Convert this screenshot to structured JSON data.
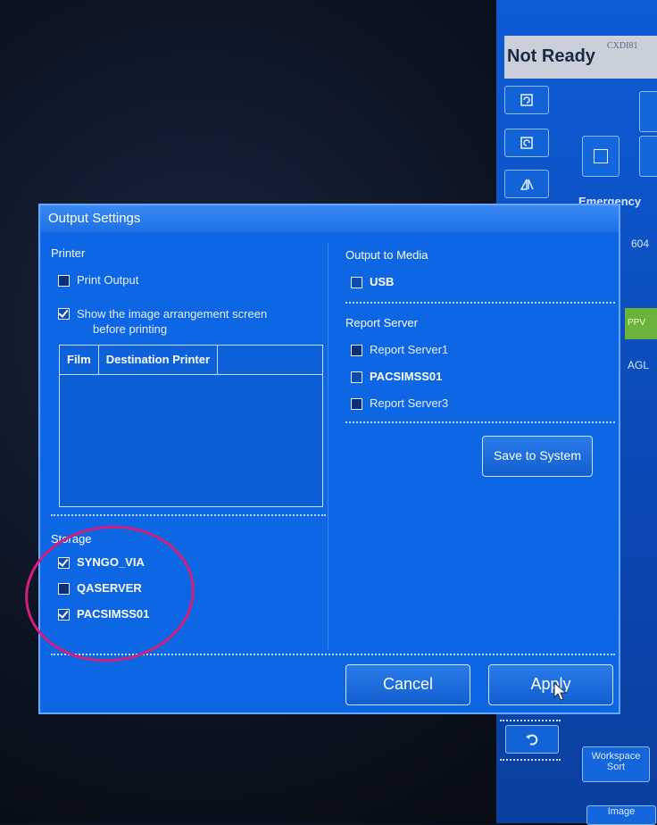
{
  "background": {
    "status": "Not Ready",
    "device_model": "CXDI81",
    "emergency_label": "Emergency",
    "number_fragment": "604",
    "code_fragment_1": "PPV",
    "code_fragment_2": "AGL",
    "workspace_sort_label": "Workspace Sort",
    "image_label": "Image"
  },
  "dialog": {
    "title": "Output Settings",
    "printer": {
      "section_label": "Printer",
      "print_output_label": "Print Output",
      "print_output_checked": false,
      "show_arrangement_label_line1": "Show the image arrangement screen",
      "show_arrangement_label_line2": "before printing",
      "show_arrangement_checked": true,
      "table_columns": [
        "Film",
        "Destination Printer"
      ]
    },
    "storage": {
      "section_label": "Storage",
      "items": [
        {
          "label": "SYNGO_VIA",
          "checked": true
        },
        {
          "label": "QASERVER",
          "checked": false
        },
        {
          "label": "PACSIMSS01",
          "checked": true
        }
      ]
    },
    "output_to_media": {
      "section_label": "Output to Media",
      "items": [
        {
          "label": "USB",
          "checked": false
        }
      ]
    },
    "report_server": {
      "section_label": "Report Server",
      "items": [
        {
          "label": "Report Server1",
          "checked": false
        },
        {
          "label": "PACSIMSS01",
          "checked": false
        },
        {
          "label": "Report Server3",
          "checked": false
        }
      ]
    },
    "save_to_system_label": "Save to System",
    "cancel_label": "Cancel",
    "apply_label": "Apply"
  },
  "colors": {
    "dialog_bg": "#0d66e3",
    "annotation_circle": "#d11f7c"
  }
}
